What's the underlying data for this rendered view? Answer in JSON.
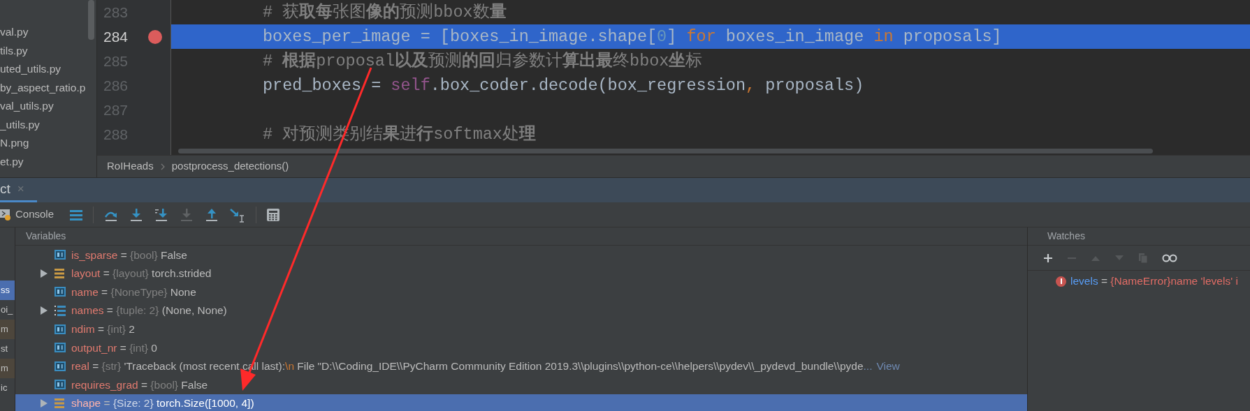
{
  "project_files": [
    {
      "name": "val.py"
    },
    {
      "name": "tils.py"
    },
    {
      "name": "uted_utils.py"
    },
    {
      "name": "by_aspect_ratio.p"
    },
    {
      "name": "val_utils.py"
    },
    {
      "name": "_utils.py"
    },
    {
      "name": "N.png"
    },
    {
      "name": "et.py"
    }
  ],
  "editor": {
    "lines": [
      {
        "number": "283",
        "breakpoint": false,
        "current": false,
        "tokens": [
          {
            "kind": "comment",
            "text": "# 获**取每**张图**像的**预测bbox数**量**"
          }
        ]
      },
      {
        "number": "284",
        "breakpoint": true,
        "current": true,
        "tokens": [
          {
            "kind": "plain",
            "text": "boxes_per_image = [boxes_in_image.shape["
          },
          {
            "kind": "number",
            "text": "0"
          },
          {
            "kind": "plain",
            "text": "] "
          },
          {
            "kind": "keyword",
            "text": "for"
          },
          {
            "kind": "plain",
            "text": " boxes_in_image "
          },
          {
            "kind": "keyword",
            "text": "in"
          },
          {
            "kind": "plain",
            "text": " proposals]"
          }
        ]
      },
      {
        "number": "285",
        "breakpoint": false,
        "current": false,
        "tokens": [
          {
            "kind": "comment",
            "text": "# **根据**proposal**以及**预测**的回**归参数计**算出最**终bbox**坐**标"
          }
        ]
      },
      {
        "number": "286",
        "breakpoint": false,
        "current": false,
        "tokens": [
          {
            "kind": "plain",
            "text": "pred_boxes = "
          },
          {
            "kind": "self",
            "text": "self"
          },
          {
            "kind": "plain",
            "text": ".box_coder.decode(box_regression"
          },
          {
            "kind": "keyword",
            "text": ","
          },
          {
            "kind": "plain",
            "text": " proposals)"
          }
        ]
      },
      {
        "number": "287",
        "breakpoint": false,
        "current": false
      },
      {
        "number": "288",
        "breakpoint": false,
        "current": false,
        "tokens": [
          {
            "kind": "comment",
            "text": "# 对预测类别结**果**进**行**softmax处**理**"
          }
        ]
      }
    ],
    "breadcrumbs": [
      "RoIHeads",
      "postprocess_detections()"
    ]
  },
  "debug_tab": {
    "label": "ct",
    "selected": true,
    "close": "×"
  },
  "toolbar": [
    {
      "kind": "console",
      "label": "Console",
      "disabled": false
    },
    {
      "kind": "menu",
      "disabled": false
    },
    {
      "kind": "step-over",
      "disabled": false
    },
    {
      "kind": "step-into",
      "disabled": false
    },
    {
      "kind": "step-into-my-code",
      "disabled": false
    },
    {
      "kind": "force-step-into",
      "disabled": true
    },
    {
      "kind": "step-out",
      "disabled": false
    },
    {
      "kind": "run-to-cursor",
      "disabled": false
    },
    {
      "kind": "evaluate",
      "disabled": false
    }
  ],
  "frames": [
    {
      "text": "ss",
      "selected": true,
      "kind": "frame"
    },
    {
      "text": "oi_",
      "selected": false,
      "kind": "frame"
    },
    {
      "text": "m",
      "selected": false,
      "kind": "library"
    },
    {
      "text": "st",
      "selected": false,
      "kind": "frame"
    },
    {
      "text": "m",
      "selected": false,
      "kind": "library"
    },
    {
      "text": "ic",
      "selected": false,
      "kind": "frame"
    }
  ],
  "variables": {
    "title": "Variables",
    "rows": [
      {
        "kind": "field",
        "expandable": false,
        "name": "is_sparse",
        "equals": "=",
        "type": "{bool}",
        "value": "False",
        "selected": false
      },
      {
        "kind": "object",
        "expandable": true,
        "name": "layout",
        "equals": "=",
        "type": "{layout}",
        "value": "torch.strided",
        "selected": false
      },
      {
        "kind": "field",
        "expandable": false,
        "name": "name",
        "equals": "=",
        "type": "{NoneType}",
        "value": "None",
        "selected": false
      },
      {
        "kind": "tuple",
        "expandable": true,
        "name": "names",
        "equals": "=",
        "type": "{tuple: 2}",
        "value": "(None, None)",
        "selected": false
      },
      {
        "kind": "field",
        "expandable": false,
        "name": "ndim",
        "equals": "=",
        "type": "{int}",
        "value": "2",
        "selected": false
      },
      {
        "kind": "field",
        "expandable": false,
        "name": "output_nr",
        "equals": "=",
        "type": "{int}",
        "value": "0",
        "selected": false
      },
      {
        "kind": "field",
        "expandable": false,
        "name": "real",
        "equals": "=",
        "type": "{str}",
        "value": [
          {
            "kind": "text",
            "text": "'Traceback (most recent call last):"
          },
          {
            "kind": "escape",
            "text": "\\n"
          },
          {
            "kind": "text",
            "text": "  File \"D:\\\\Coding_IDE\\\\PyCharm Community Edition 2019.3\\\\plugins\\\\python-ce\\\\helpers\\\\pydev\\\\_pydevd_bundle\\\\pyde"
          },
          {
            "kind": "ellipsis",
            "text": "..."
          }
        ],
        "link": "View",
        "selected": false
      },
      {
        "kind": "field",
        "expandable": false,
        "name": "requires_grad",
        "equals": "=",
        "type": "{bool}",
        "value": "False",
        "selected": false
      },
      {
        "kind": "object",
        "expandable": true,
        "name": "shape",
        "equals": "=",
        "type": "{Size: 2}",
        "value": "torch.Size([1000, 4])",
        "selected": true
      }
    ]
  },
  "watches": {
    "title": "Watches",
    "tools": [
      {
        "kind": "add",
        "disabled": false
      },
      {
        "kind": "remove",
        "disabled": true
      },
      {
        "kind": "up",
        "disabled": true
      },
      {
        "kind": "down",
        "disabled": true
      },
      {
        "kind": "copy",
        "disabled": true
      },
      {
        "kind": "inline",
        "disabled": false
      }
    ],
    "items": [
      {
        "error": true,
        "name": "levels",
        "equals": "=",
        "value": "{NameError}name 'levels' i"
      }
    ]
  }
}
